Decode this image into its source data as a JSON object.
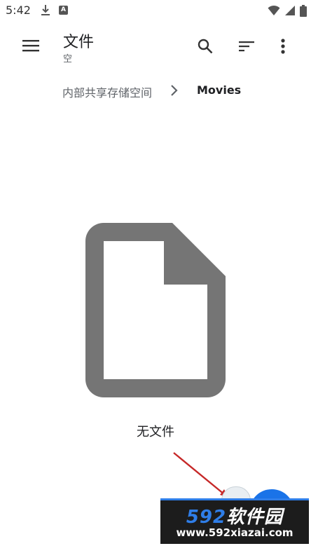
{
  "status_bar": {
    "time": "5:42",
    "app_badge": "A"
  },
  "app_bar": {
    "title": "文件",
    "subtitle": "空"
  },
  "breadcrumb": {
    "root": "内部共享存储空间",
    "current": "Movies"
  },
  "empty_state": {
    "message": "无文件"
  },
  "watermark": {
    "brand_num": "592",
    "brand_text": "软件园",
    "url": "www.592xiazai.com"
  },
  "colors": {
    "icon_gray": "#757575",
    "fab_blue": "#1a73e8",
    "arrow_red": "#c62828"
  },
  "icons": [
    "download-icon",
    "app-icon",
    "wifi-icon",
    "signal-icon",
    "battery-icon",
    "menu-icon",
    "search-icon",
    "sort-icon",
    "more-vert-icon",
    "chevron-right-icon",
    "file-icon"
  ]
}
